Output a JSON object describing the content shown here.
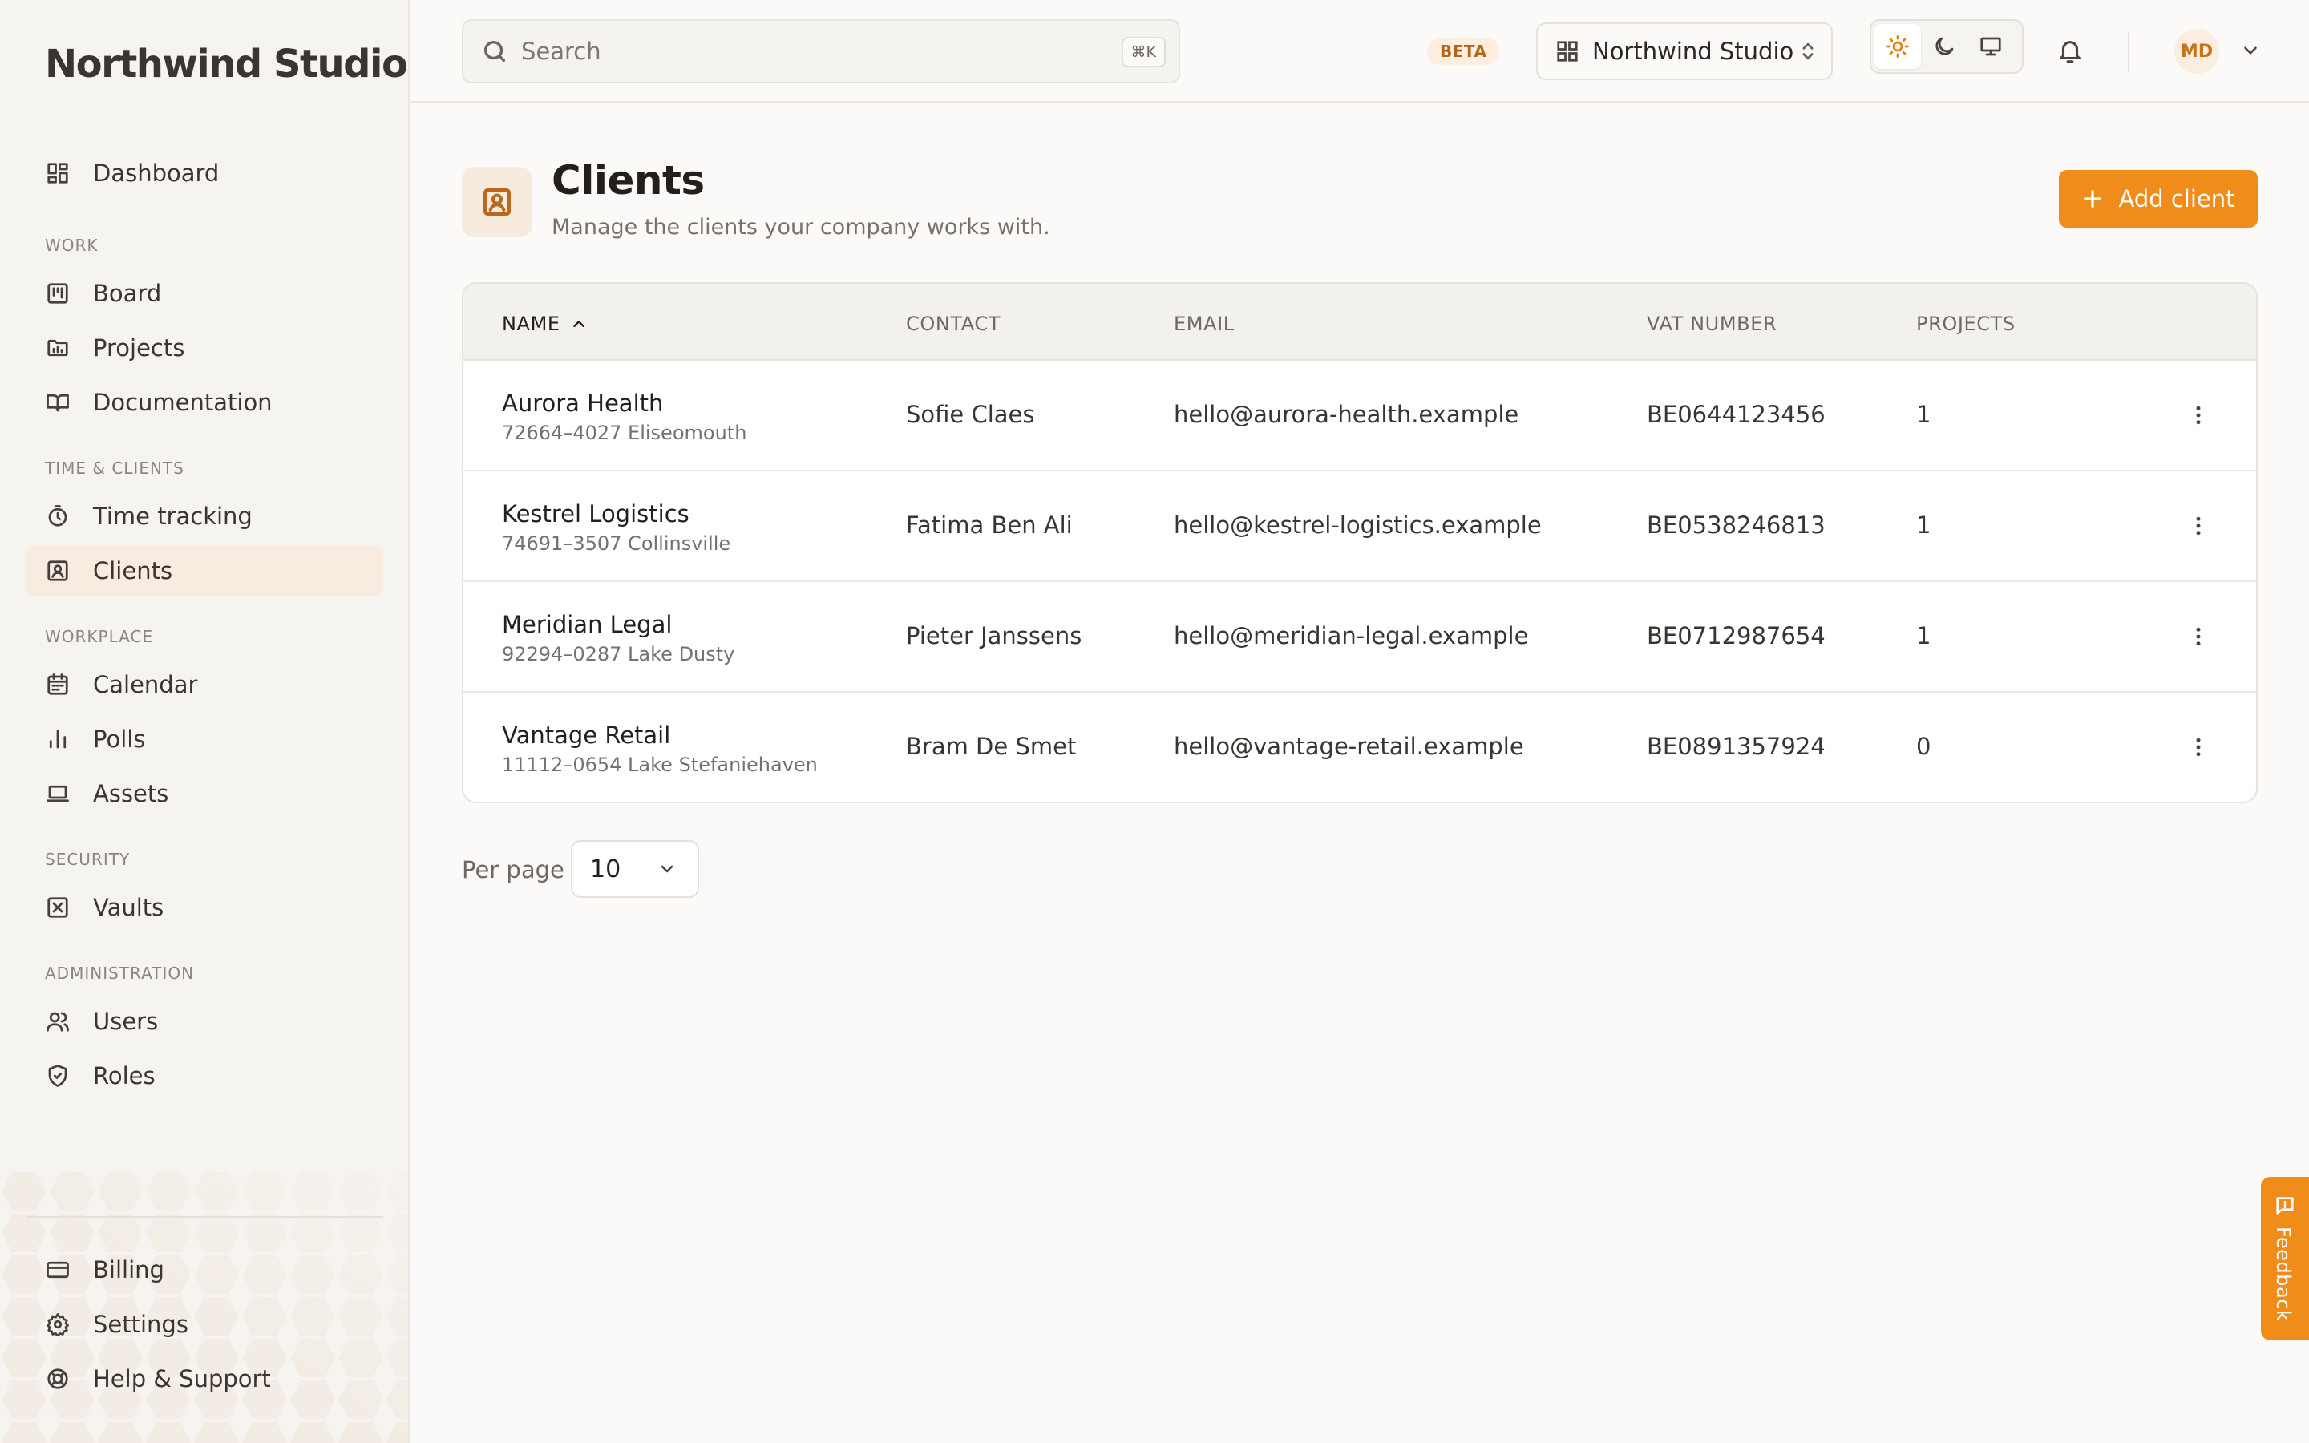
{
  "app": {
    "brand": "Northwind Studio"
  },
  "sidebar": {
    "dashboard": "Dashboard",
    "sections": {
      "work": "WORK",
      "time_clients": "TIME & CLIENTS",
      "workplace": "WORKPLACE",
      "security": "SECURITY",
      "administration": "ADMINISTRATION"
    },
    "items": {
      "board": "Board",
      "projects": "Projects",
      "documentation": "Documentation",
      "time_tracking": "Time tracking",
      "clients": "Clients",
      "calendar": "Calendar",
      "polls": "Polls",
      "assets": "Assets",
      "vaults": "Vaults",
      "users": "Users",
      "roles": "Roles",
      "billing": "Billing",
      "settings": "Settings",
      "help": "Help & Support"
    },
    "active": "clients"
  },
  "header": {
    "search_placeholder": "Search",
    "search_shortcut": "⌘K",
    "beta_label": "BETA",
    "workspace_name": "Northwind Studio",
    "theme_selected": "light",
    "avatar_initials": "MD"
  },
  "page": {
    "title": "Clients",
    "subtitle": "Manage the clients your company works with.",
    "add_button": "Add client"
  },
  "table": {
    "columns": {
      "name": "NAME",
      "contact": "CONTACT",
      "email": "EMAIL",
      "vat": "VAT NUMBER",
      "projects": "PROJECTS"
    },
    "sort": {
      "column": "name",
      "direction": "asc"
    },
    "rows": [
      {
        "name": "Aurora Health",
        "address": "72664–4027 Eliseomouth",
        "contact": "Sofie Claes",
        "email": "hello@aurora-health.example",
        "vat": "BE0644123456",
        "projects": "1"
      },
      {
        "name": "Kestrel Logistics",
        "address": "74691–3507 Collinsville",
        "contact": "Fatima Ben Ali",
        "email": "hello@kestrel-logistics.example",
        "vat": "BE0538246813",
        "projects": "1"
      },
      {
        "name": "Meridian Legal",
        "address": "92294–0287 Lake Dusty",
        "contact": "Pieter Janssens",
        "email": "hello@meridian-legal.example",
        "vat": "BE0712987654",
        "projects": "1"
      },
      {
        "name": "Vantage Retail",
        "address": "11112–0654 Lake Stefaniehaven",
        "contact": "Bram De Smet",
        "email": "hello@vantage-retail.example",
        "vat": "BE0891357924",
        "projects": "0"
      }
    ]
  },
  "pagination": {
    "per_page_label": "Per page",
    "per_page_value": "10"
  },
  "feedback": {
    "label": "Feedback"
  },
  "colors": {
    "accent": "#f08c1a",
    "active_bg": "#f8ece0",
    "sidebar_bg": "#f6f4f1"
  }
}
